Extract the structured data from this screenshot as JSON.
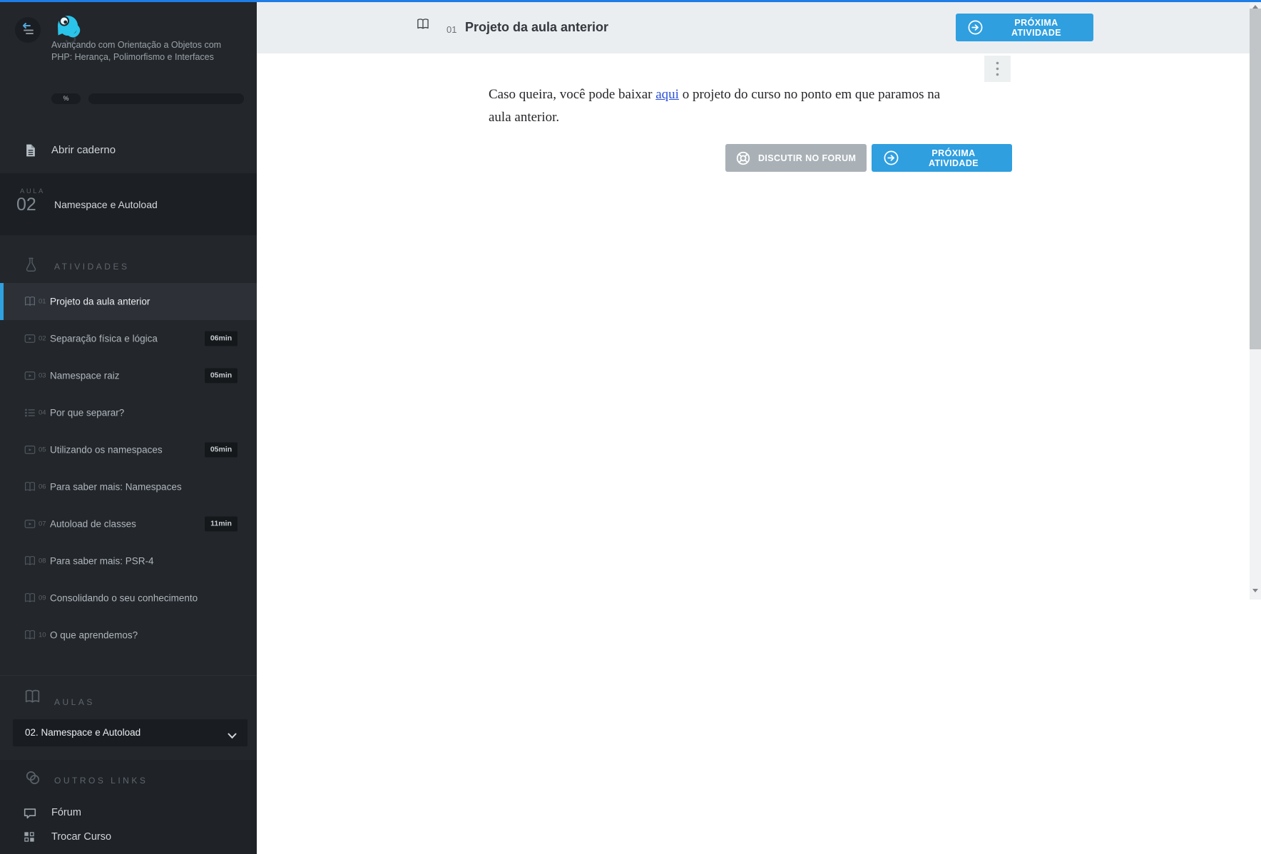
{
  "colors": {
    "accent_blue": "#2f9fe0",
    "topline_blue": "#1f7de6",
    "sidebar_bg": "#23262b",
    "header_bg": "#ebeef0",
    "link_blue": "#2b50d8",
    "logo_cyan": "#2ac3e9"
  },
  "sidebar": {
    "course_title": "Avançando com Orientação a Objetos com PHP: Herança, Polimorfismo e Interfaces",
    "progress_percent_label": "%",
    "open_notebook_label": "Abrir caderno",
    "lesson_badge": {
      "kicker": "AULA",
      "number": "02",
      "name": "Namespace e Autoload"
    },
    "activities_header": "ATIVIDADES",
    "activities": [
      {
        "number": "01",
        "label": "Projeto da aula anterior",
        "icon": "book-open-icon",
        "duration": "",
        "active": true
      },
      {
        "number": "02",
        "label": "Separação física e lógica",
        "icon": "video-icon",
        "duration": "06min",
        "active": false
      },
      {
        "number": "03",
        "label": "Namespace raiz",
        "icon": "video-icon",
        "duration": "05min",
        "active": false
      },
      {
        "number": "04",
        "label": "Por que separar?",
        "icon": "list-icon",
        "duration": "",
        "active": false
      },
      {
        "number": "05",
        "label": "Utilizando os namespaces",
        "icon": "video-icon",
        "duration": "05min",
        "active": false
      },
      {
        "number": "06",
        "label": "Para saber mais: Namespaces",
        "icon": "book-open-icon",
        "duration": "",
        "active": false
      },
      {
        "number": "07",
        "label": "Autoload de classes",
        "icon": "video-icon",
        "duration": "11min",
        "active": false
      },
      {
        "number": "08",
        "label": "Para saber mais: PSR-4",
        "icon": "book-open-icon",
        "duration": "",
        "active": false
      },
      {
        "number": "09",
        "label": "Consolidando o seu conhecimento",
        "icon": "book-open-icon",
        "duration": "",
        "active": false
      },
      {
        "number": "10",
        "label": "O que aprendemos?",
        "icon": "book-open-icon",
        "duration": "",
        "active": false
      }
    ],
    "aulas_header": "AULAS",
    "lesson_select_value": "02. Namespace e Autoload",
    "outros_header": "OUTROS LINKS",
    "links": [
      {
        "label": "Fórum",
        "icon": "chat-icon"
      },
      {
        "label": "Trocar Curso",
        "icon": "grid-icon"
      }
    ]
  },
  "header": {
    "activity_number": "01",
    "title": "Projeto da aula anterior",
    "next_button": "PRÓXIMA ATIVIDADE"
  },
  "content": {
    "text_before": "Caso queira, você pode baixar ",
    "link_text": "aqui",
    "text_after": " o projeto do curso no ponto em que paramos na aula anterior.",
    "forum_button": "DISCUTIR NO FORUM",
    "next_button": "PRÓXIMA ATIVIDADE"
  }
}
